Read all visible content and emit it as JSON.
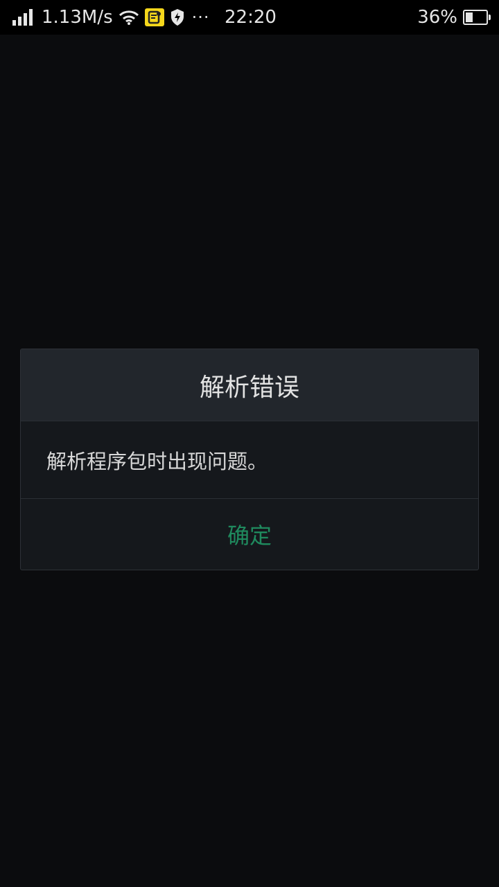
{
  "status_bar": {
    "network_speed": "1.13M/s",
    "time": "22:20",
    "battery_percent": "36%",
    "battery_level": 0.36,
    "more_indicator": "···"
  },
  "dialog": {
    "title": "解析错误",
    "message": "解析程序包时出现问题。",
    "confirm_label": "确定"
  },
  "colors": {
    "background": "#0b0c0e",
    "dialog_header": "#22262c",
    "dialog_body": "#15181c",
    "accent": "#1f8a5e"
  }
}
